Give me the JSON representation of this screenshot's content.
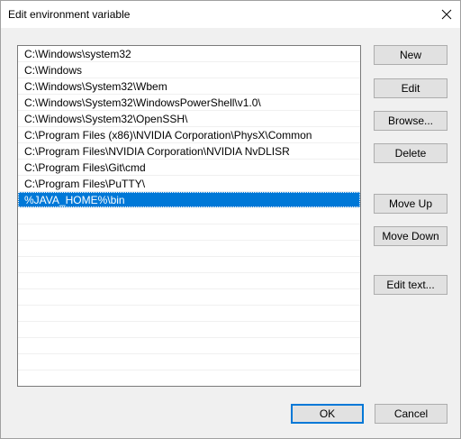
{
  "window": {
    "title": "Edit environment variable"
  },
  "list": {
    "items": [
      "C:\\Windows\\system32",
      "C:\\Windows",
      "C:\\Windows\\System32\\Wbem",
      "C:\\Windows\\System32\\WindowsPowerShell\\v1.0\\",
      "C:\\Windows\\System32\\OpenSSH\\",
      "C:\\Program Files (x86)\\NVIDIA Corporation\\PhysX\\Common",
      "C:\\Program Files\\NVIDIA Corporation\\NVIDIA NvDLISR",
      "C:\\Program Files\\Git\\cmd",
      "C:\\Program Files\\PuTTY\\",
      "%JAVA_HOME%\\bin"
    ],
    "selected_index": 9
  },
  "buttons": {
    "new": "New",
    "edit": "Edit",
    "browse": "Browse...",
    "delete": "Delete",
    "move_up": "Move Up",
    "move_down": "Move Down",
    "edit_text": "Edit text...",
    "ok": "OK",
    "cancel": "Cancel"
  },
  "icons": {
    "close": "close-icon"
  },
  "colors": {
    "selection": "#0078d7",
    "window_bg": "#f0f0f0",
    "button_bg": "#e1e1e1",
    "default_button_border": "#0078d7"
  }
}
